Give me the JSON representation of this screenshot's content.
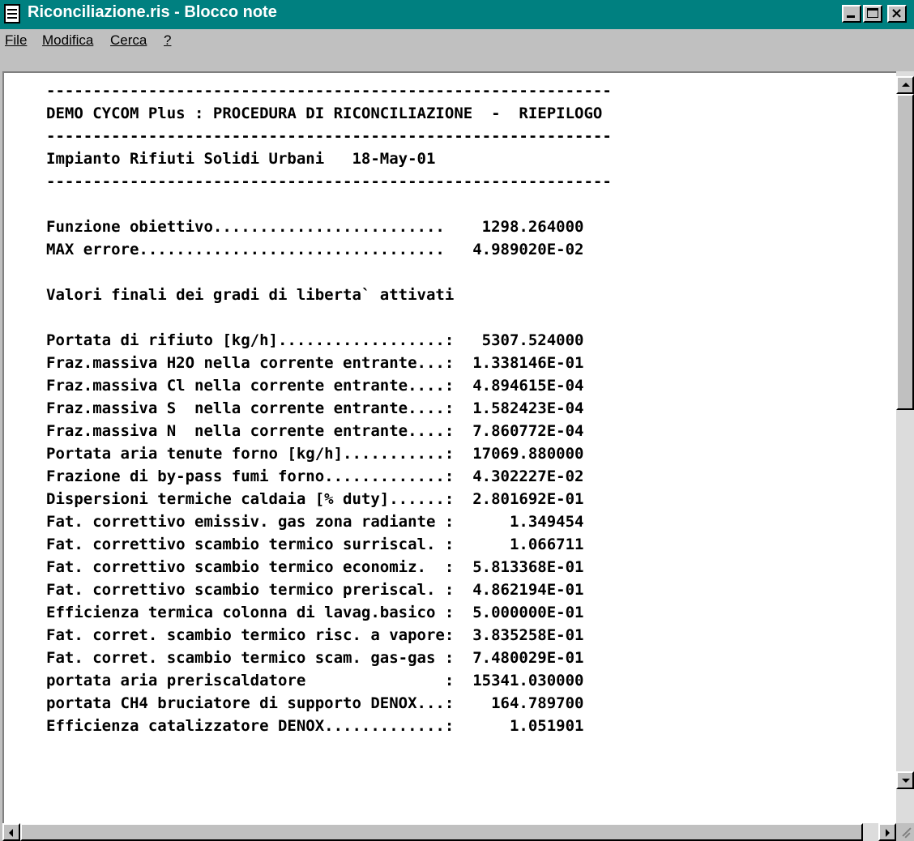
{
  "window": {
    "title": "Riconciliazione.ris - Blocco note"
  },
  "menu": {
    "items": [
      {
        "label": "File"
      },
      {
        "label": "Modifica"
      },
      {
        "label": "Cerca"
      },
      {
        "label": "?"
      }
    ]
  },
  "document": {
    "lines": [
      "-------------------------------------------------------------",
      "DEMO CYCOM Plus : PROCEDURA DI RICONCILIAZIONE  -  RIEPILOGO",
      "-------------------------------------------------------------",
      "Impianto Rifiuti Solidi Urbani   18-May-01",
      "-------------------------------------------------------------",
      "",
      "Funzione obiettivo.........................    1298.264000",
      "MAX errore.................................   4.989020E-02",
      "",
      "Valori finali dei gradi di liberta` attivati",
      "",
      "Portata di rifiuto [kg/h]..................:   5307.524000",
      "Fraz.massiva H2O nella corrente entrante...:  1.338146E-01",
      "Fraz.massiva Cl nella corrente entrante....:  4.894615E-04",
      "Fraz.massiva S  nella corrente entrante....:  1.582423E-04",
      "Fraz.massiva N  nella corrente entrante....:  7.860772E-04",
      "Portata aria tenute forno [kg/h]...........:  17069.880000",
      "Frazione di by-pass fumi forno.............:  4.302227E-02",
      "Dispersioni termiche caldaia [% duty]......:  2.801692E-01",
      "Fat. correttivo emissiv. gas zona radiante :      1.349454",
      "Fat. correttivo scambio termico surriscal. :      1.066711",
      "Fat. correttivo scambio termico economiz.  :  5.813368E-01",
      "Fat. correttivo scambio termico preriscal. :  4.862194E-01",
      "Efficienza termica colonna di lavag.basico :  5.000000E-01",
      "Fat. corret. scambio termico risc. a vapore:  3.835258E-01",
      "Fat. corret. scambio termico scam. gas-gas :  7.480029E-01",
      "portata aria preriscaldatore               :  15341.030000",
      "portata CH4 bruciatore di supporto DENOX...:    164.789700",
      "Efficienza catalizzatore DENOX.............:      1.051901"
    ]
  },
  "colors": {
    "titlebar": "#008080",
    "window_bg": "#c0c0c0",
    "text": "#000000"
  },
  "icons": {
    "app": "notepad-icon",
    "minimize": "minimize-icon",
    "maximize": "maximize-icon",
    "close": "close-icon"
  }
}
